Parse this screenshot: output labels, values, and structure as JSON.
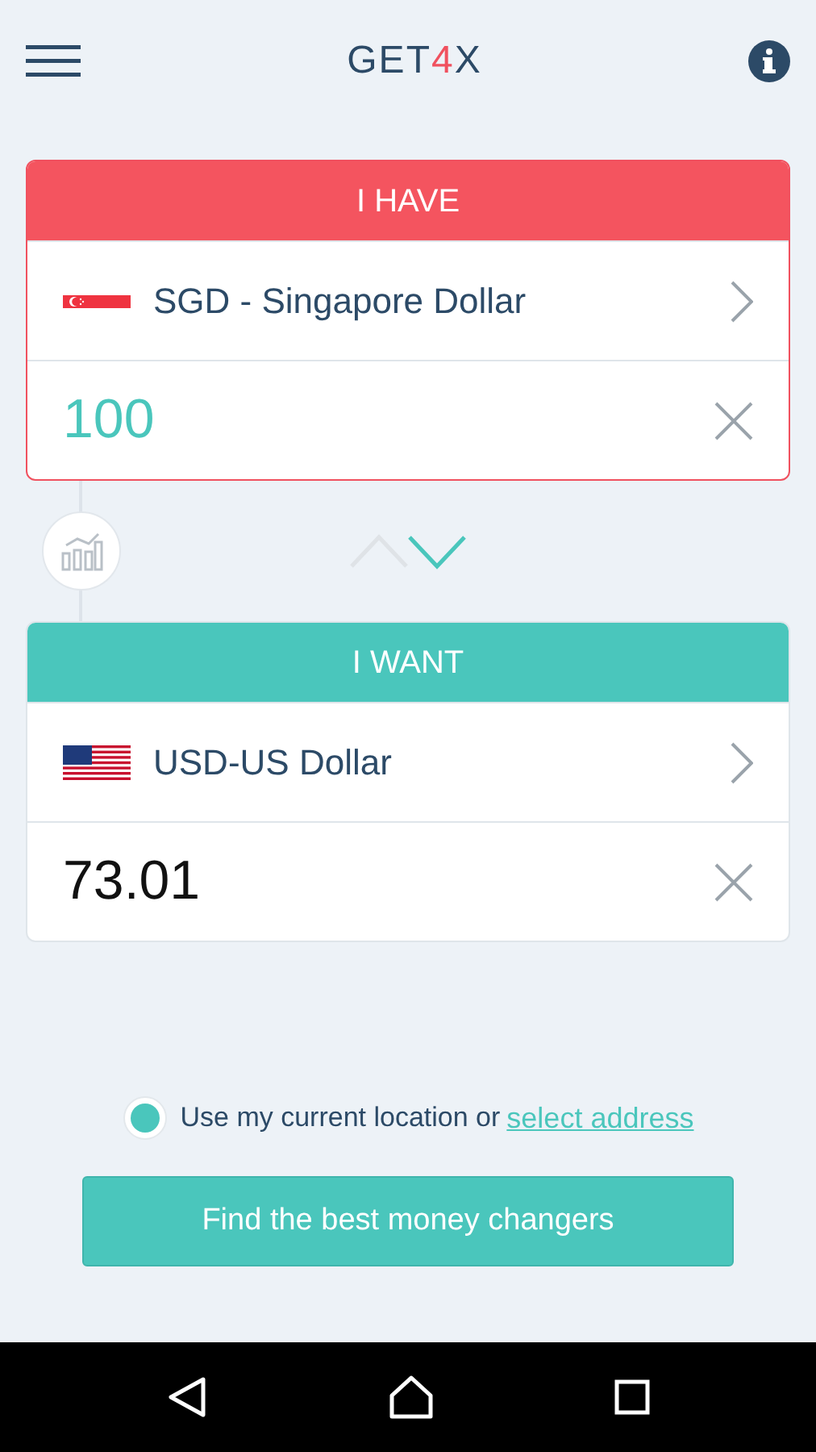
{
  "logo": [
    {
      "text": "GET",
      "color": "#2c4a67"
    },
    {
      "text": "4",
      "color": "#f0515f"
    },
    {
      "text": "X",
      "color": "#2c4a67"
    }
  ],
  "cards": [
    {
      "kind": "have",
      "title": "I HAVE",
      "flag": {
        "kind": "sg"
      },
      "currency": "SGD - Singapore Dollar",
      "amount": "100",
      "focused": true
    },
    {
      "kind": "want",
      "title": "I WANT",
      "flag": {
        "kind": "us"
      },
      "currency": "USD-US Dollar",
      "amount": "73.01",
      "focused": false
    }
  ],
  "direction": [
    {
      "kind": "up",
      "selected": false
    },
    {
      "kind": "down",
      "selected": true
    }
  ],
  "location": {
    "selected": true,
    "text": "Use my current location or",
    "link": "select address"
  },
  "button": "Find the best money changers"
}
